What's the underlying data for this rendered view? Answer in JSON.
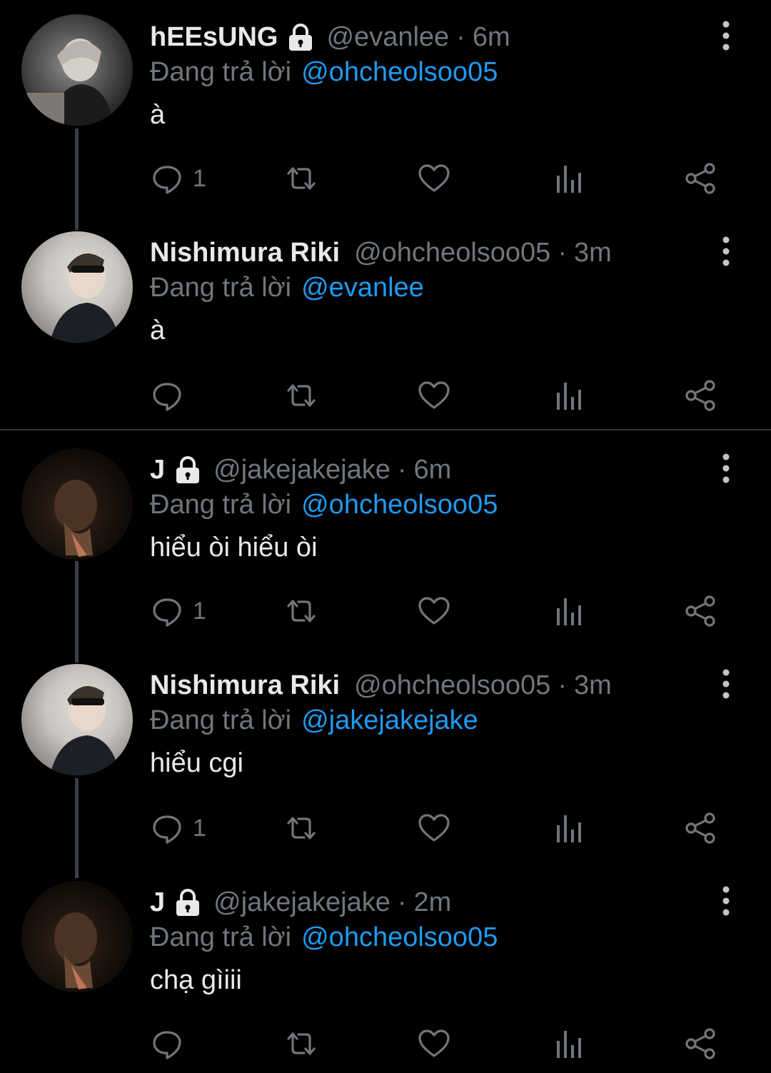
{
  "tweets": [
    {
      "name": "hEEsUNG",
      "locked": true,
      "handle": "@evanlee",
      "time": "6m",
      "reply_prefix": "Đang trả lời",
      "reply_to": "@ohcheolsoo05",
      "text": "à",
      "reply_count": "1",
      "avatar": "avatar-heesung"
    },
    {
      "name": "Nishimura Riki",
      "locked": false,
      "handle": "@ohcheolsoo05",
      "time": "3m",
      "reply_prefix": "Đang trả lời",
      "reply_to": "@evanlee",
      "text": "à",
      "reply_count": "",
      "avatar": "avatar-riki"
    },
    {
      "name": "J",
      "locked": true,
      "handle": "@jakejakejake",
      "time": "6m",
      "reply_prefix": "Đang trả lời",
      "reply_to": "@ohcheolsoo05",
      "text": "hiểu òi hiểu òi",
      "reply_count": "1",
      "avatar": "avatar-jake"
    },
    {
      "name": "Nishimura Riki",
      "locked": false,
      "handle": "@ohcheolsoo05",
      "time": "3m",
      "reply_prefix": "Đang trả lời",
      "reply_to": "@jakejakejake",
      "text": "hiểu cgi",
      "reply_count": "1",
      "avatar": "avatar-riki"
    },
    {
      "name": "J",
      "locked": true,
      "handle": "@jakejakejake",
      "time": "2m",
      "reply_prefix": "Đang trả lời",
      "reply_to": "@ohcheolsoo05",
      "text": "chạ gìiii",
      "reply_count": "",
      "avatar": "avatar-jake"
    }
  ],
  "separator": "·",
  "icons": {
    "reply": "reply-bubble-icon",
    "retweet": "retweet-icon",
    "like": "heart-icon",
    "views": "analytics-bars-icon",
    "share": "share-icon",
    "more": "more-vertical-icon",
    "locked": "lock-icon"
  },
  "colors": {
    "background": "#000000",
    "text": "#e7e9ea",
    "muted": "#71767b",
    "link": "#1d9bf0",
    "thread_line": "#3a3f44"
  }
}
